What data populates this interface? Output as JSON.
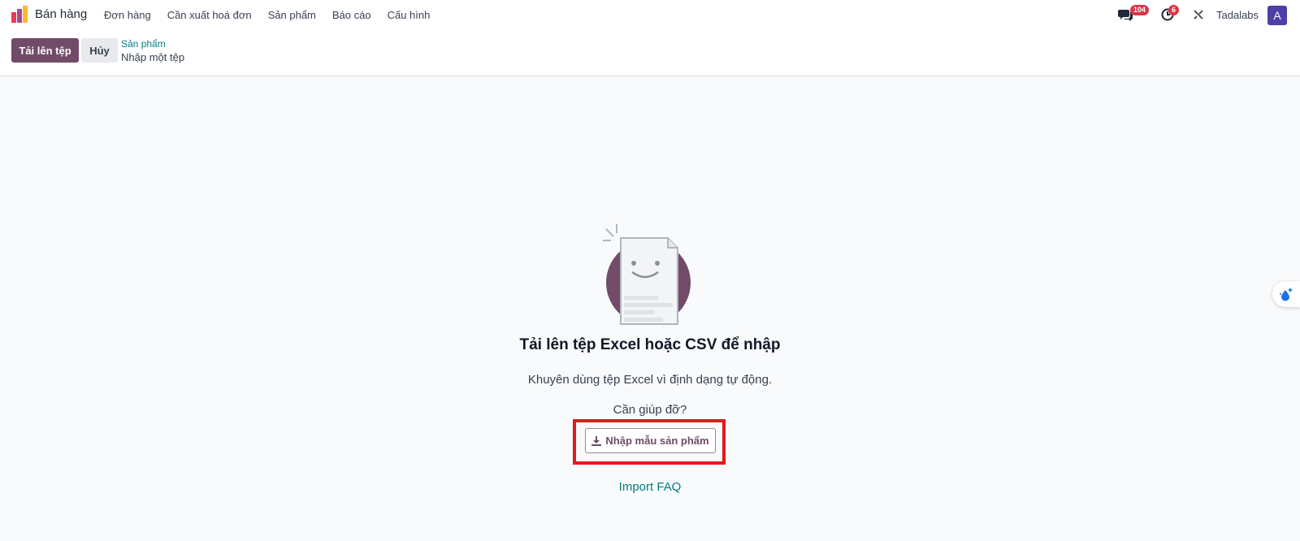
{
  "navbar": {
    "app_name": "Bán hàng",
    "menu": [
      "Đơn hàng",
      "Cần xuất hoá đơn",
      "Sản phẩm",
      "Báo cáo",
      "Cấu hình"
    ],
    "messages_badge": "104",
    "activities_badge": "6",
    "company": "Tadalabs",
    "avatar_letter": "A"
  },
  "control_panel": {
    "upload_label": "Tải lên tệp",
    "cancel_label": "Hủy",
    "breadcrumb_parent": "Sản phẩm",
    "breadcrumb_current": "Nhập một tệp"
  },
  "main": {
    "title": "Tải lên tệp Excel hoặc CSV để nhập",
    "subtitle": "Khuyên dùng tệp Excel vì định dạng tự động.",
    "help_text": "Cần giúp đỡ?",
    "template_button": "Nhập mẫu sản phẩm",
    "faq_link": "Import FAQ"
  },
  "colors": {
    "brand": "#714b67",
    "link": "#017e84",
    "badge": "#dc3545",
    "highlight": "#e11b1b",
    "avatar": "#4c3fa8"
  }
}
